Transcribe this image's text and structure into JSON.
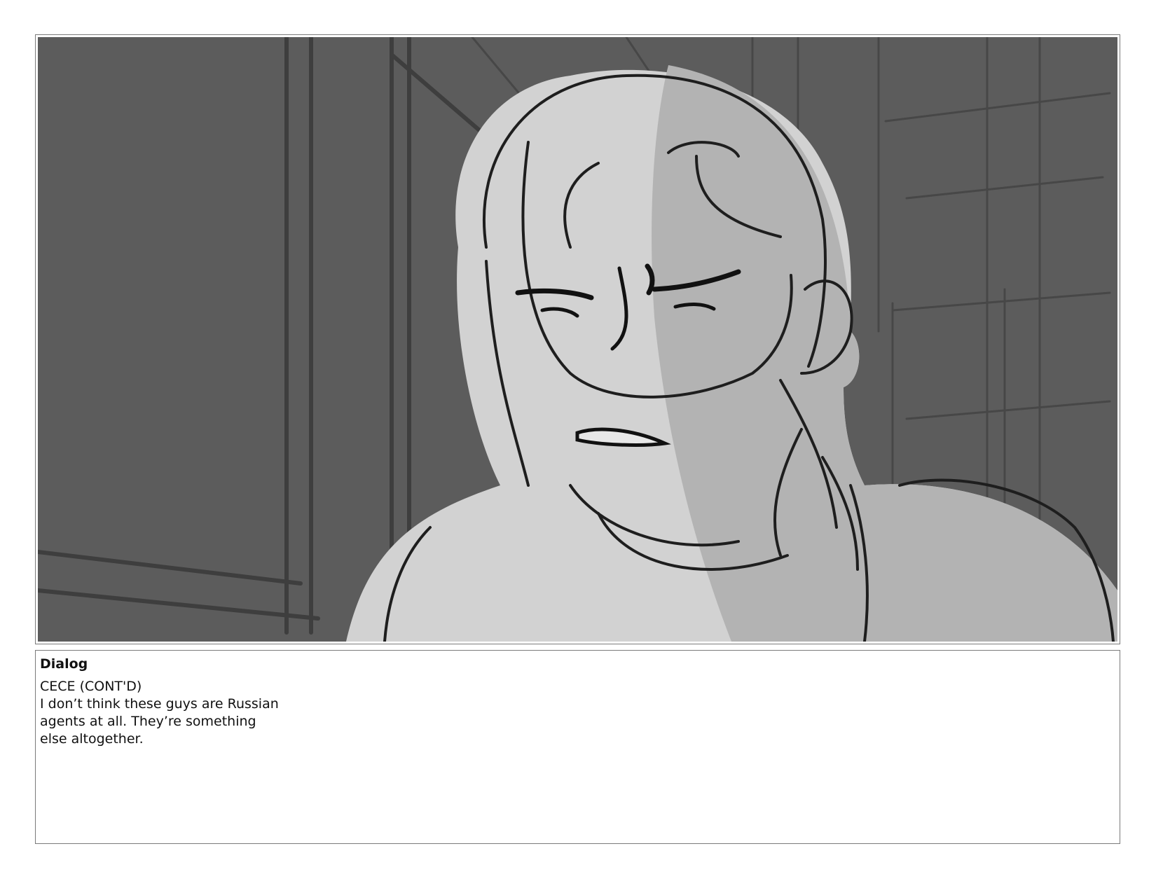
{
  "panel": {
    "image_description_icon": "storyboard-sketch-image"
  },
  "dialog": {
    "heading": "Dialog",
    "lines": [
      "CECE (CONT'D)",
      "I don’t think these guys are Russian",
      "agents at all. They’re something",
      "else altogether."
    ]
  }
}
